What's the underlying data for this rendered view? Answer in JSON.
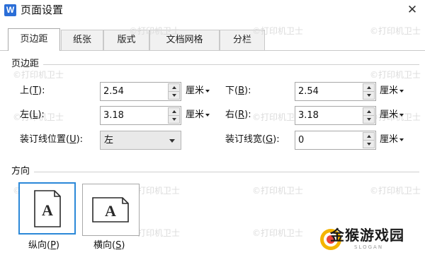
{
  "window": {
    "app_icon_letter": "W",
    "title": "页面设置",
    "close_glyph": "✕"
  },
  "tabs": [
    {
      "label": "页边距",
      "active": true
    },
    {
      "label": "纸张",
      "active": false
    },
    {
      "label": "版式",
      "active": false
    },
    {
      "label": "文档网格",
      "active": false
    },
    {
      "label": "分栏",
      "active": false
    }
  ],
  "margins": {
    "section_title": "页边距",
    "top": {
      "label_pre": "上(",
      "key": "T",
      "label_post": "):",
      "value": "2.54",
      "unit": "厘米"
    },
    "bottom": {
      "label_pre": "下(",
      "key": "B",
      "label_post": "):",
      "value": "2.54",
      "unit": "厘米"
    },
    "left": {
      "label_pre": "左(",
      "key": "L",
      "label_post": "):",
      "value": "3.18",
      "unit": "厘米"
    },
    "right": {
      "label_pre": "右(",
      "key": "R",
      "label_post": "):",
      "value": "3.18",
      "unit": "厘米"
    },
    "gutter_position": {
      "label_pre": "装订线位置(",
      "key": "U",
      "label_post": "):",
      "value": "左"
    },
    "gutter_width": {
      "label_pre": "装订线宽(",
      "key": "G",
      "label_post": "):",
      "value": "0",
      "unit": "厘米"
    }
  },
  "orientation": {
    "section_title": "方向",
    "portrait": {
      "label_pre": "纵向(",
      "key": "P",
      "label_post": ")",
      "selected": true,
      "icon": "portrait-page-icon"
    },
    "landscape": {
      "label_pre": "横向(",
      "key": "S",
      "label_post": ")",
      "selected": false,
      "icon": "landscape-page-icon"
    }
  },
  "watermark": {
    "text": "打印机卫士",
    "copyright_glyph": "©"
  },
  "brand": {
    "name": "金猴游戏园",
    "sub": "SLOGAN"
  },
  "colors": {
    "accent": "#2b88d8",
    "app_icon": "#2b6ed7"
  }
}
